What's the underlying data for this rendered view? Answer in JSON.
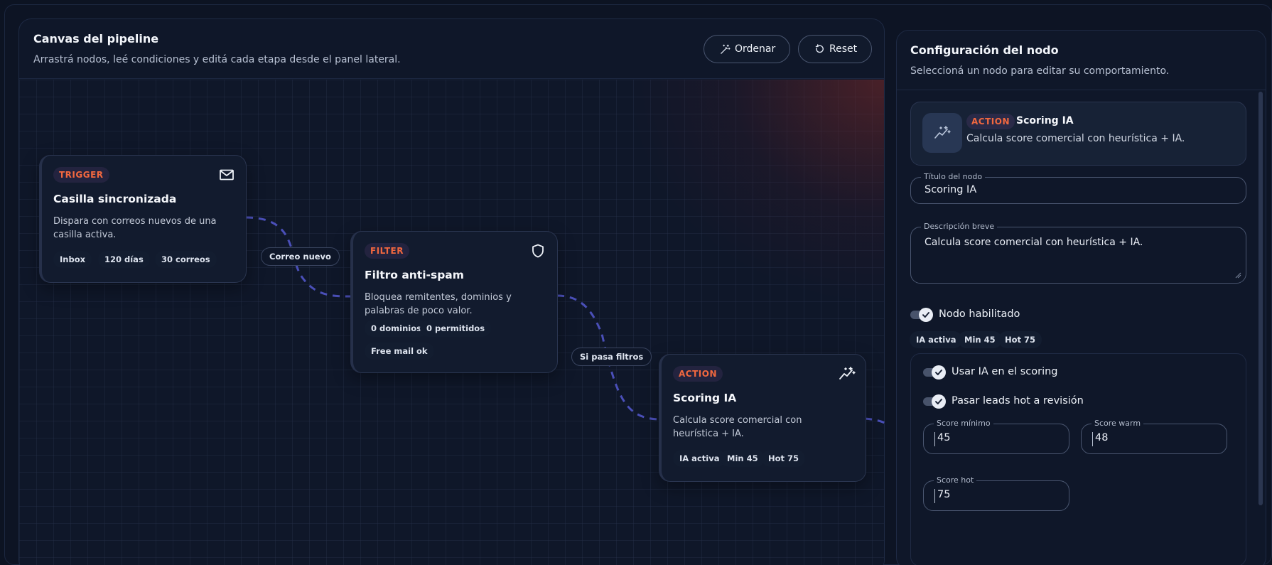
{
  "canvas": {
    "title": "Canvas del pipeline",
    "subtitle": "Arrastrá nodos, leé condiciones y editá cada etapa desde el panel lateral.",
    "order_button": "Ordenar",
    "reset_button": "Reset",
    "edge_labels": [
      "Correo nuevo",
      "Si pasa filtros"
    ],
    "nodes": [
      {
        "type": "TRIGGER",
        "icon": "mail-icon",
        "title": "Casilla sincronizada",
        "description": "Dispara con correos nuevos de una casilla activa.",
        "chips": [
          "Inbox",
          "120 días",
          "30 correos"
        ]
      },
      {
        "type": "FILTER",
        "icon": "shield-icon",
        "title": "Filtro anti-spam",
        "description": "Bloquea remitentes, dominios y palabras de poco valor.",
        "chips": [
          "0 dominios",
          "0 permitidos",
          "Free mail ok"
        ]
      },
      {
        "type": "ACTION",
        "icon": "sparkle-chart-icon",
        "title": "Scoring IA",
        "description": "Calcula score comercial con heurística + IA.",
        "chips": [
          "IA activa",
          "Min 45",
          "Hot 75"
        ]
      }
    ]
  },
  "config": {
    "title": "Configuración del nodo",
    "subtitle": "Seleccioná un nodo para editar su comportamiento.",
    "summary": {
      "badge": "ACTION",
      "title": "Scoring IA",
      "description": "Calcula score comercial con heurística + IA."
    },
    "node_title_label": "Título del nodo",
    "node_title_value": "Scoring IA",
    "description_label": "Descripción breve",
    "description_value": "Calcula score comercial con heurística + IA.",
    "enabled_label": "Nodo habilitado",
    "enabled": true,
    "chips": [
      "IA activa",
      "Min 45",
      "Hot 75"
    ],
    "use_ai_label": "Usar IA en el scoring",
    "use_ai": true,
    "hot_review_label": "Pasar leads hot a revisión",
    "hot_review": true,
    "score_min_label": "Score mínimo",
    "score_min_value": "45",
    "score_warm_label": "Score warm",
    "score_warm_value": "48",
    "score_hot_label": "Score hot",
    "score_hot_value": "75"
  },
  "colors": {
    "accent": "#f2683f",
    "edge": "#4a4fb8",
    "background": "#0c1322"
  }
}
